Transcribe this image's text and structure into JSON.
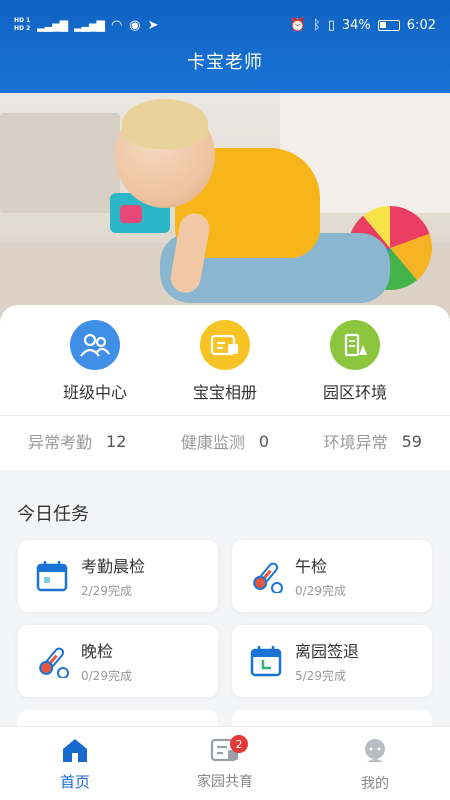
{
  "status_bar": {
    "network": "4G",
    "battery": "34%",
    "time": "6:02"
  },
  "app": {
    "title": "卡宝老师"
  },
  "shortcuts": [
    {
      "label": "班级中心",
      "icon": "class-center-icon",
      "color": "#3f8fe6"
    },
    {
      "label": "宝宝相册",
      "icon": "album-icon",
      "color": "#f7c325"
    },
    {
      "label": "园区环境",
      "icon": "environment-icon",
      "color": "#8cc63f"
    }
  ],
  "stats": [
    {
      "label": "异常考勤",
      "value": "12"
    },
    {
      "label": "健康监测",
      "value": "0"
    },
    {
      "label": "环境异常",
      "value": "59"
    }
  ],
  "tasks": {
    "title": "今日任务",
    "items": [
      {
        "name": "考勤晨检",
        "progress": "2/29完成",
        "icon": "calendar-icon"
      },
      {
        "name": "午检",
        "progress": "0/29完成",
        "icon": "thermometer-icon"
      },
      {
        "name": "晚检",
        "progress": "0/29完成",
        "icon": "thermometer-icon"
      },
      {
        "name": "离园签退",
        "progress": "5/29完成",
        "icon": "calendar-clock-icon"
      }
    ]
  },
  "nav": {
    "tabs": [
      {
        "label": "首页",
        "icon": "home-icon",
        "active": true
      },
      {
        "label": "家园共育",
        "icon": "message-icon",
        "badge": "2"
      },
      {
        "label": "我的",
        "icon": "profile-icon"
      }
    ]
  },
  "colors": {
    "primary": "#1769cc",
    "badge": "#e53935"
  }
}
